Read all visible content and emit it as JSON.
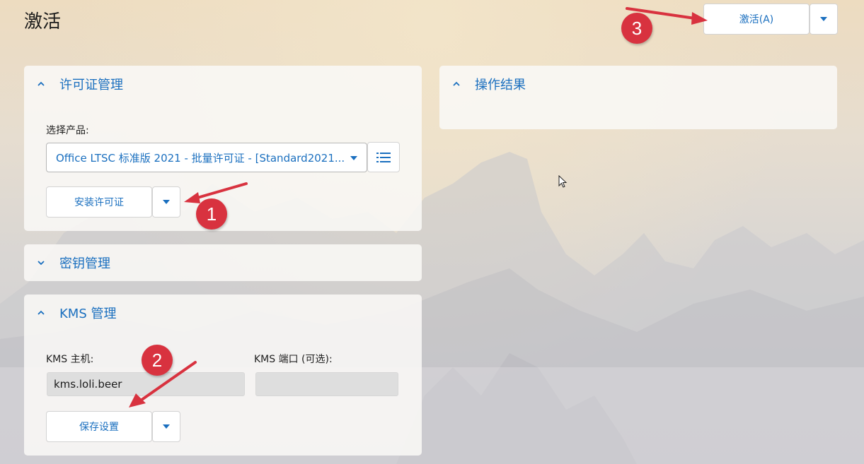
{
  "page": {
    "title": "激活"
  },
  "toolbar": {
    "activate_label": "激活(A)"
  },
  "license_panel": {
    "title": "许可证管理",
    "product_label": "选择产品:",
    "product_value": "Office LTSC 标准版 2021 - 批量许可证 - [Standard2021...",
    "install_label": "安装许可证"
  },
  "key_panel": {
    "title": "密钥管理"
  },
  "kms_panel": {
    "title": "KMS 管理",
    "host_label": "KMS 主机:",
    "host_value": "kms.loli.beer",
    "port_label": "KMS 端口 (可选):",
    "port_value": "",
    "save_label": "保存设置"
  },
  "result_panel": {
    "title": "操作结果"
  },
  "annotations": [
    {
      "number": "1"
    },
    {
      "number": "2"
    },
    {
      "number": "3"
    }
  ],
  "colors": {
    "accent": "#1a6fbf",
    "badge": "#d8323f"
  }
}
